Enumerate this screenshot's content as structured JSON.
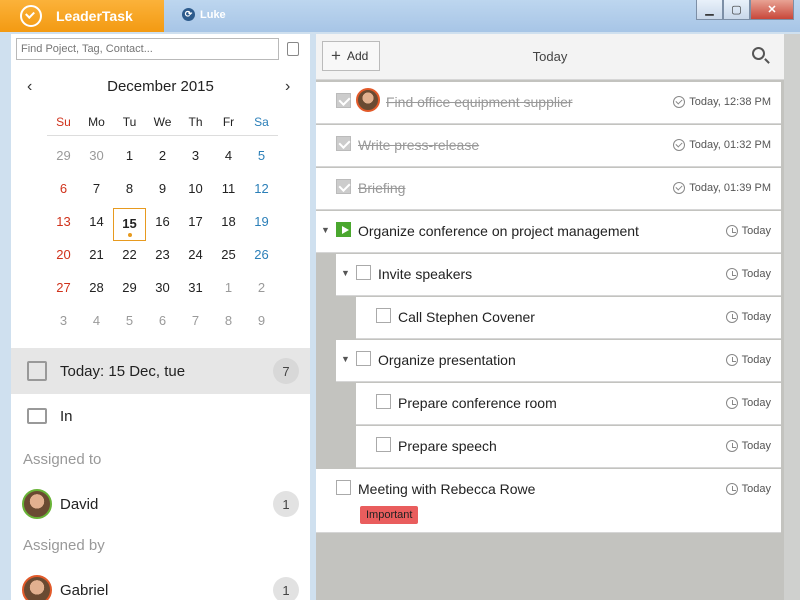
{
  "app": {
    "title": "LeaderTask",
    "user": "Luke"
  },
  "window_controls": {
    "minimize": "▁",
    "maximize": "▢",
    "close": "✕"
  },
  "sidebar": {
    "search_placeholder": "Find Poject, Tag, Contact...",
    "calendar": {
      "month_label": "December 2015",
      "prev_label": "‹",
      "next_label": "›",
      "weekdays": [
        "Su",
        "Mo",
        "Tu",
        "We",
        "Th",
        "Fr",
        "Sa"
      ],
      "weeks": [
        [
          "29",
          "30",
          "1",
          "2",
          "3",
          "4",
          "5"
        ],
        [
          "6",
          "7",
          "8",
          "9",
          "10",
          "11",
          "12"
        ],
        [
          "13",
          "14",
          "15",
          "16",
          "17",
          "18",
          "19"
        ],
        [
          "20",
          "21",
          "22",
          "23",
          "24",
          "25",
          "26"
        ],
        [
          "27",
          "28",
          "29",
          "30",
          "31",
          "1",
          "2"
        ],
        [
          "3",
          "4",
          "5",
          "6",
          "7",
          "8",
          "9"
        ]
      ]
    },
    "today": {
      "label": "Today: 15 Dec, tue",
      "count": "7"
    },
    "inbox": {
      "label": "In"
    },
    "assigned_to": {
      "heading": "Assigned to",
      "people": [
        {
          "name": "David",
          "count": "1"
        }
      ]
    },
    "assigned_by": {
      "heading": "Assigned by",
      "people": [
        {
          "name": "Gabriel",
          "count": "1"
        }
      ]
    }
  },
  "main": {
    "add_label": "Add",
    "view_title": "Today",
    "tasks": [
      {
        "title": "Find office equipment supplier",
        "when": "Today, 12:38 PM"
      },
      {
        "title": "Write press-release",
        "when": "Today, 01:32 PM"
      },
      {
        "title": "Briefing",
        "when": "Today, 01:39 PM"
      },
      {
        "title": "Organize conference on project management",
        "when": "Today"
      },
      {
        "title": "Invite speakers",
        "when": "Today"
      },
      {
        "title": "Call Stephen Covener",
        "when": "Today"
      },
      {
        "title": "Organize presentation",
        "when": "Today"
      },
      {
        "title": "Prepare conference room",
        "when": "Today"
      },
      {
        "title": "Prepare speech",
        "when": "Today"
      },
      {
        "title": "Meeting with Rebecca Rowe",
        "when": "Today",
        "tag": "Important"
      }
    ]
  },
  "colors": {
    "accent": "#f39a12",
    "green": "#4aa72e",
    "tag": "#e95d5d",
    "sunday": "#d0321b",
    "saturday": "#2b7fb8"
  }
}
